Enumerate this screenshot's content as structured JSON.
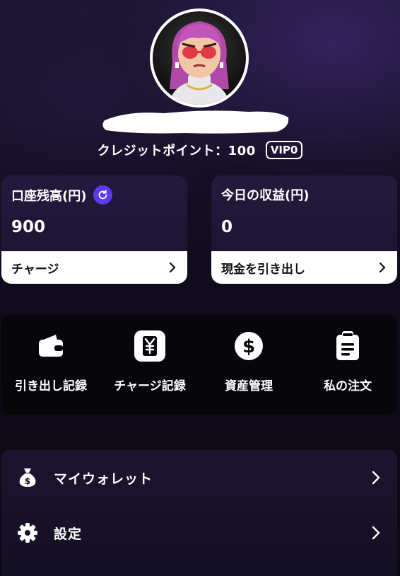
{
  "profile": {
    "credit_label": "クレジットポイント：100",
    "vip_badge": "VIP0"
  },
  "cards": {
    "balance": {
      "title": "口座残高(円)",
      "value": "900",
      "action_label": "チャージ",
      "icon": "refresh-icon"
    },
    "today": {
      "title": "今日の収益(円)",
      "value": "0",
      "action_label": "現金を引き出し"
    }
  },
  "quick_menu": [
    {
      "label": "引き出し記録",
      "icon": "wallet-icon"
    },
    {
      "label": "チャージ記録",
      "icon": "yen-receipt-icon"
    },
    {
      "label": "資産管理",
      "icon": "dollar-circle-icon"
    },
    {
      "label": "私の注文",
      "icon": "clipboard-icon"
    }
  ],
  "menu_list": [
    {
      "label": "マイウォレット",
      "icon": "money-bag-icon"
    },
    {
      "label": "設定",
      "icon": "gear-icon"
    }
  ],
  "colors": {
    "accent": "#5a3df0",
    "background": "#120d1f",
    "card": "#1f1636"
  }
}
